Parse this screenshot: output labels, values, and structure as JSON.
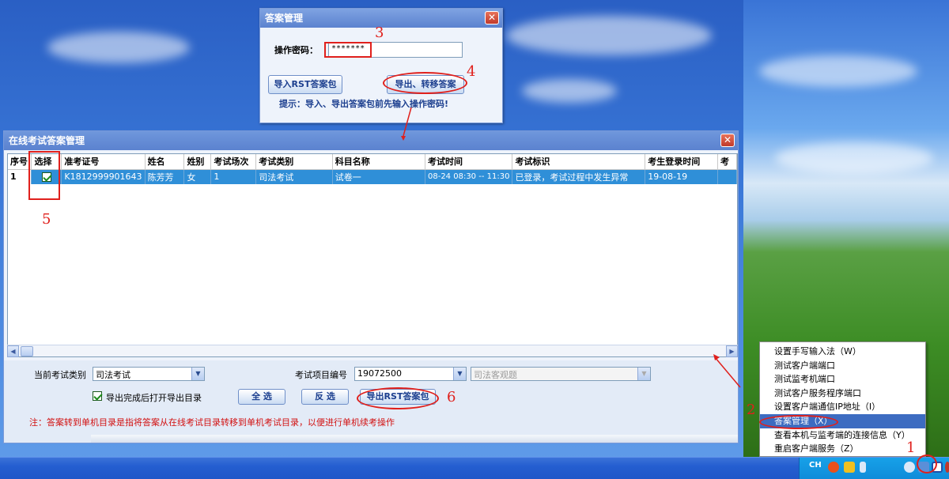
{
  "small_dialog": {
    "title": "答案管理",
    "password_label": "操作密码：",
    "password_value": "*******",
    "import_button": "导入RST答案包",
    "export_button": "导出、转移答案",
    "hint": "提示：导入、导出答案包前先输入操作密码!"
  },
  "main_window": {
    "title": "在线考试答案管理",
    "columns": [
      "序号",
      "选择",
      "准考证号",
      "姓名",
      "姓别",
      "考试场次",
      "考试类别",
      "科目名称",
      "考试时间",
      "考试标识",
      "考生登录时间",
      "考"
    ],
    "rows": [
      {
        "index": "1",
        "checked": true,
        "exam_no": "K1812999901643",
        "name": "陈芳芳",
        "gender": "女",
        "session": "1",
        "category": "司法考试",
        "subject": "试卷一",
        "time": "08-24 08:30 -- 11:30",
        "flag": "已登录，考试过程中发生异常",
        "login_time": "19-08-19"
      }
    ],
    "category_label": "当前考试类别",
    "category_value": "司法考试",
    "project_label": "考试项目编号",
    "project_value": "19072500",
    "project_name_value": "司法客观题",
    "open_after_export_label": "导出完成后打开导出目录",
    "open_after_export_checked": true,
    "select_all_button": "全 选",
    "invert_button": "反 选",
    "export_rst_button": "导出RST答案包",
    "note": "注：答案转到单机目录是指将答案从在线考试目录转移到单机考试目录，以便进行单机续考操作"
  },
  "context_menu": {
    "items": [
      "设置手写输入法（W）",
      "测试客户端端口",
      "测试监考机端口",
      "测试客户服务程序端口",
      "设置客户端通信IP地址（I）",
      "答案管理（X）",
      "查看本机与监考端的连接信息（Y）",
      "重启客户端服务（Z）"
    ],
    "highlighted_index": 5
  },
  "annotations": [
    "1",
    "2",
    "3",
    "4",
    "5",
    "6"
  ],
  "taskbar": {
    "lang": "CH"
  }
}
